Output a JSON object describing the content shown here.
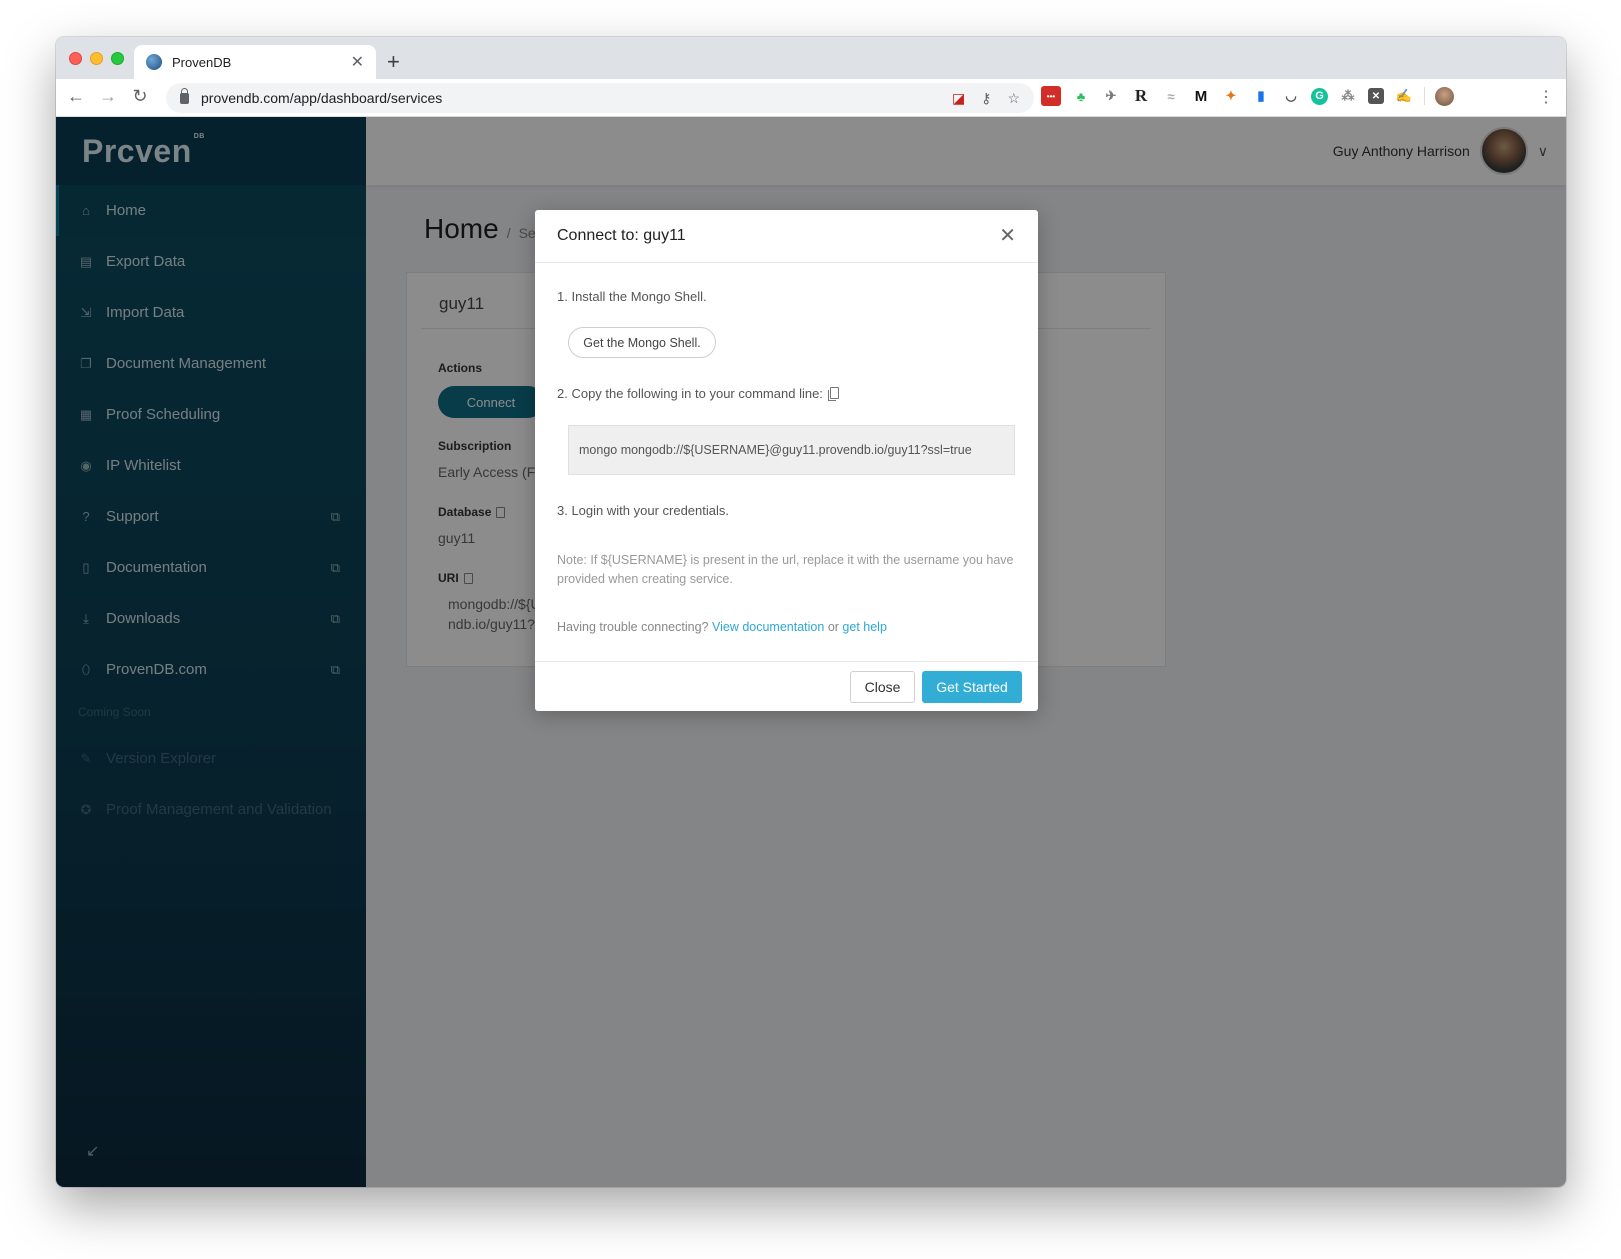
{
  "browser": {
    "tab_title": "ProvenDB",
    "url": "provendb.com/app/dashboard/services",
    "extensions": [
      "lastpass-icon",
      "evernote-icon",
      "bird-icon",
      "r-icon",
      "handshake-icon",
      "medium-icon",
      "metamask-icon",
      "bookmark-icon",
      "pocket-icon",
      "grammarly-icon",
      "tree-icon",
      "box-icon",
      "signature-icon"
    ]
  },
  "sidebar": {
    "logo": "Prcven",
    "logo_sup": "DB",
    "items": [
      {
        "label": "Home",
        "icon": "home-icon"
      },
      {
        "label": "Export Data",
        "icon": "export-icon"
      },
      {
        "label": "Import Data",
        "icon": "import-icon"
      },
      {
        "label": "Document Management",
        "icon": "documents-icon"
      },
      {
        "label": "Proof Scheduling",
        "icon": "calendar-icon"
      },
      {
        "label": "IP Whitelist",
        "icon": "location-pin-icon"
      },
      {
        "label": "Support",
        "icon": "question-icon"
      },
      {
        "label": "Documentation",
        "icon": "file-icon"
      },
      {
        "label": "Downloads",
        "icon": "download-icon"
      },
      {
        "label": "ProvenDB.com",
        "icon": "shield-icon"
      }
    ],
    "coming_soon": "Coming Soon",
    "disabled_items": [
      {
        "label": "Version Explorer",
        "icon": "compass-icon"
      },
      {
        "label": "Proof Management and Validation",
        "icon": "award-icon"
      }
    ]
  },
  "header": {
    "user_name": "Guy Anthony Harrison"
  },
  "page": {
    "title": "Home",
    "breadcrumb": "Serv"
  },
  "card": {
    "title": "guy11",
    "actions_label": "Actions",
    "connect_label": "Connect",
    "subscription_label": "Subscription",
    "subscription_value": "Early Access (Free",
    "database_label": "Database",
    "database_value": "guy11",
    "uri_label": "URI",
    "uri_line1": "mongodb://${US",
    "uri_line2": "ndb.io/guy11?ss"
  },
  "modal": {
    "title": "Connect to: guy11",
    "step1": "1. Install the Mongo Shell.",
    "shell_button": "Get the Mongo Shell.",
    "step2": "2. Copy the following in to your command line:",
    "command": "mongo mongodb://${USERNAME}@guy11.provendb.io/guy11?ssl=true",
    "step3": "3. Login with your credentials.",
    "note": "Note: If ${USERNAME} is present in the url, replace it with the username you have provided when creating service.",
    "trouble_text": "Having trouble connecting?",
    "docs_link": "View documentation",
    "or_text": "or",
    "help_link": "get help",
    "close_label": "Close",
    "start_label": "Get Started"
  }
}
